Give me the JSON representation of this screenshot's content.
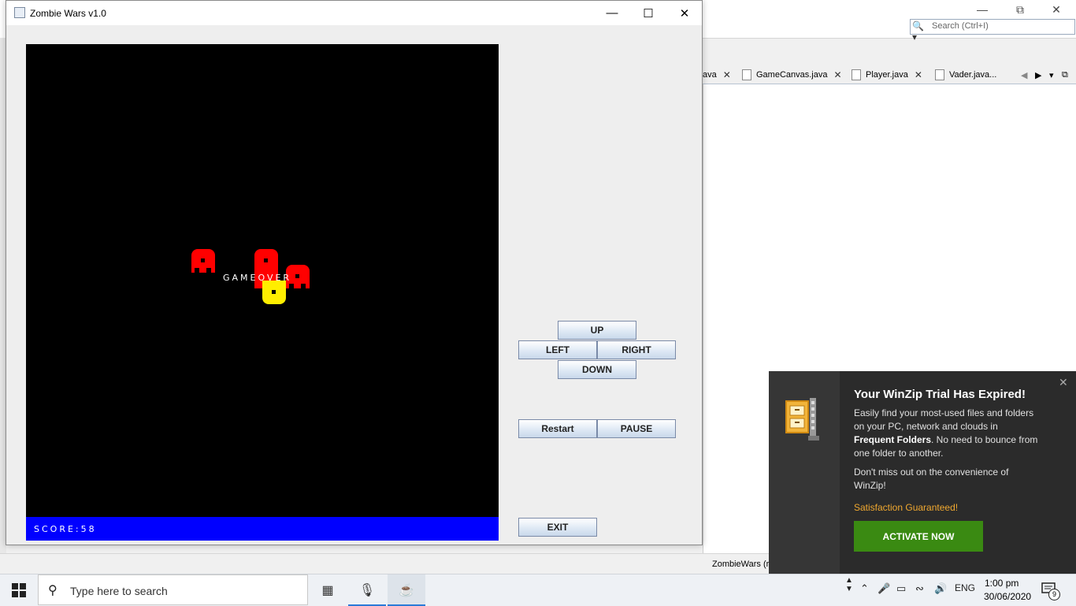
{
  "ide": {
    "search_placeholder": "Search (Ctrl+I)",
    "tabs": [
      {
        "label": "ava"
      },
      {
        "label": "GameCanvas.java"
      },
      {
        "label": "Player.java"
      },
      {
        "label": "Vader.java..."
      }
    ],
    "status_text": "ZombieWars (ru"
  },
  "game_window": {
    "title": "Zombie Wars v1.0",
    "gameover_text": "GAMEOVER",
    "score_text": "SCORE:58",
    "buttons": {
      "up": "UP",
      "left": "LEFT",
      "right": "RIGHT",
      "down": "DOWN",
      "restart": "Restart",
      "pause": "PAUSE",
      "exit": "EXIT"
    },
    "colors": {
      "zombie": "#ff0000",
      "player": "#ffee00",
      "canvas": "#000000",
      "score_bar": "#0000ff"
    }
  },
  "toast": {
    "title": "Your WinZip Trial Has Expired!",
    "body1_pre": "Easily find your most-used files and folders on your PC, network and clouds in ",
    "body1_bold": "Frequent Folders",
    "body1_post": ". No need to bounce from one folder to another.",
    "body2": "Don't miss out on the convenience of WinZip!",
    "guarantee": "Satisfaction Guaranteed!",
    "button": "ACTIVATE NOW"
  },
  "taskbar": {
    "search_placeholder": "Type here to search",
    "language": "ENG",
    "time": "1:00 pm",
    "date": "30/06/2020",
    "notification_count": "9"
  }
}
